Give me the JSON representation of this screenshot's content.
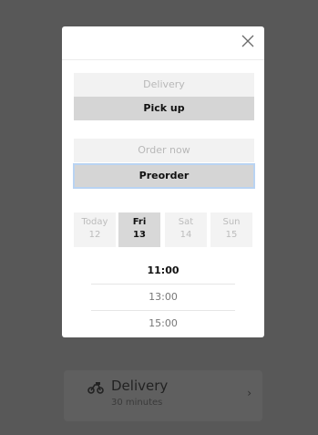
{
  "background": {
    "delivery_card": {
      "title": "Delivery",
      "subtitle": "30 minutes",
      "chevron": "›",
      "icon": "scooter-icon"
    }
  },
  "modal": {
    "close_icon": "close-icon",
    "method": {
      "options": [
        "Delivery",
        "Pick up"
      ],
      "selected": "Pick up"
    },
    "timing": {
      "options": [
        "Order now",
        "Preorder"
      ],
      "selected": "Preorder"
    },
    "days": [
      {
        "name": "Today",
        "number": "12"
      },
      {
        "name": "Fri",
        "number": "13"
      },
      {
        "name": "Sat",
        "number": "14"
      },
      {
        "name": "Sun",
        "number": "15"
      }
    ],
    "selected_day": "Fri",
    "times": [
      "11:00",
      "13:00",
      "15:00"
    ],
    "selected_time": "11:00"
  },
  "colors": {
    "overlay": "#585858",
    "selected_bg": "#d5d5d5",
    "inactive_bg": "#f2f2f2",
    "focus_ring": "#b9d3f2"
  }
}
